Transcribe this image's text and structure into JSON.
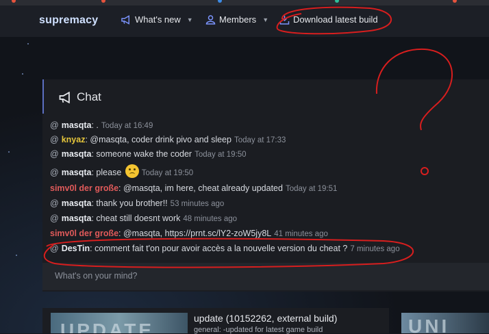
{
  "brand": {
    "name": "supremacy"
  },
  "nav": [
    {
      "label": "What's new",
      "icon": "megaphone-icon",
      "has_dropdown": true
    },
    {
      "label": "Members",
      "icon": "user-icon",
      "has_dropdown": true
    },
    {
      "label": "Download latest build",
      "icon": "download-icon",
      "has_dropdown": false
    }
  ],
  "chat": {
    "title": "Chat",
    "messages": [
      {
        "user": "masqta",
        "user_color": "#e9ecf1",
        "text": ": .",
        "time": "Today at 16:49"
      },
      {
        "user": "knyaz",
        "user_color": "#e6c63b",
        "text": ": @masqta, coder drink pivo and sleep",
        "time": "Today at 17:33"
      },
      {
        "user": "masqta",
        "user_color": "#e9ecf1",
        "text": ": someone wake the coder",
        "time": "Today at 19:50"
      },
      {
        "user": "masqta",
        "user_color": "#e9ecf1",
        "text": ": please",
        "emoji": "slightly-frowning-face",
        "time": "Today at 19:50"
      },
      {
        "user": "simv0l der große",
        "user_color": "#e05a5a",
        "text": ": @masqta, im here, cheat already updated",
        "time": "Today at 19:51"
      },
      {
        "user": "masqta",
        "user_color": "#e9ecf1",
        "text": ": thank you brother!!",
        "time": "53 minutes ago"
      },
      {
        "user": "masqta",
        "user_color": "#e9ecf1",
        "text": ": cheat still doesnt work",
        "time": "48 minutes ago"
      },
      {
        "user": "simv0l der große",
        "user_color": "#e05a5a",
        "text": ": @masqta, https://prnt.sc/lY2-zoW5jy8L",
        "time": "41 minutes ago"
      },
      {
        "user": "DesTin",
        "user_color": "#e9ecf1",
        "text": ": comment fait t'on pour avoir accès a la nouvelle version du cheat ?",
        "time": "7 minutes ago"
      }
    ],
    "input_placeholder": "What's on your mind?"
  },
  "threads": [
    {
      "thumb_text": "UPDATE",
      "title": "update (10152262, external build)",
      "subtitle": "general: -updated for latest game build"
    },
    {
      "thumb_text": "UNI"
    }
  ],
  "colors": {
    "accent": "#5c6fc2",
    "annotation": "#d81e1e"
  }
}
